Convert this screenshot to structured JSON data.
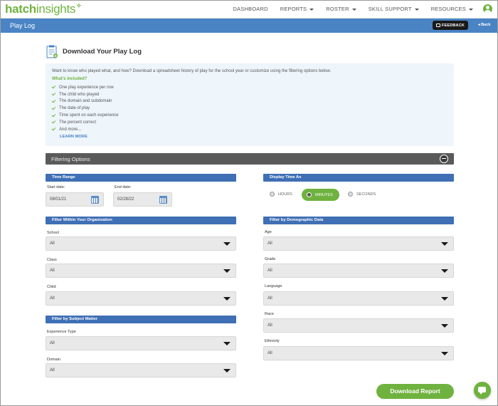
{
  "logo": {
    "hatch": "hatch",
    "insights": "insights"
  },
  "nav": {
    "items": [
      {
        "label": "DASHBOARD",
        "dropdown": false
      },
      {
        "label": "REPORTS",
        "dropdown": true
      },
      {
        "label": "ROSTER",
        "dropdown": true
      },
      {
        "label": "SKILL SUPPORT",
        "dropdown": true
      },
      {
        "label": "RESOURCES",
        "dropdown": true
      }
    ]
  },
  "titlebar": {
    "title": "Play Log",
    "feedback": "FEEDBACK",
    "back": "Back"
  },
  "heading": "Download Your Play Log",
  "info": {
    "intro": "Want to know who played what, and how? Download a spreadsheet history of play for the school year or customize using the filtering options below.",
    "included_label": "What's included?",
    "items": [
      "One play experience per row",
      "The child who played",
      "The domain and subdomain",
      "The date of play",
      "Time spent on each experience",
      "The percent correct",
      "And more..."
    ],
    "learn_more": "LEARN MORE"
  },
  "filter_bar": {
    "label": "Filtering Options"
  },
  "time_range": {
    "header": "Time Range",
    "start_label": "Start date:",
    "start_value": "08/01/21",
    "end_label": "End date:",
    "end_value": "02/28/22"
  },
  "display_time": {
    "header": "Display Time As",
    "options": [
      "HOURS",
      "MINUTES",
      "SECONDS"
    ],
    "selected": "MINUTES"
  },
  "org_filter": {
    "header": "Filter Within Your Organization",
    "fields": [
      {
        "label": "School",
        "value": "All"
      },
      {
        "label": "Class",
        "value": "All"
      },
      {
        "label": "Child",
        "value": "All"
      }
    ]
  },
  "subject_filter": {
    "header": "Filter by Subject Matter",
    "fields": [
      {
        "label": "Experience Type",
        "value": "All"
      },
      {
        "label": "Domain",
        "value": "All"
      }
    ]
  },
  "demo_filter": {
    "header": "Filter by Demographic Data",
    "fields": [
      {
        "label": "Age",
        "value": "All"
      },
      {
        "label": "Grade",
        "value": "All"
      },
      {
        "label": "Language",
        "value": "All"
      },
      {
        "label": "Race",
        "value": "All"
      },
      {
        "label": "Ethnicity",
        "value": "All"
      }
    ]
  },
  "download_button": "Download Report",
  "colors": {
    "brand_green": "#6fb23f",
    "title_blue": "#4a84c4",
    "section_blue": "#3f6fb5",
    "filter_bar": "#5a5a5a"
  }
}
